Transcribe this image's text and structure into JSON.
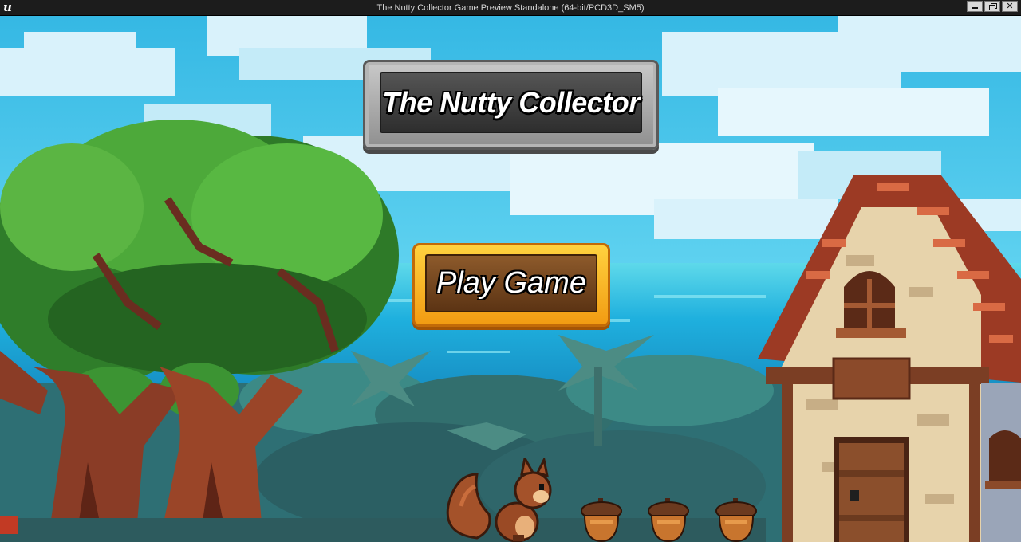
{
  "window": {
    "title": "The Nutty Collector Game Preview Standalone (64-bit/PCD3D_SM5)",
    "engine_icon": "unreal-engine-icon",
    "controls": [
      "minimize-icon",
      "restore-icon",
      "close-icon"
    ]
  },
  "menu": {
    "game_title": "The Nutty Collector",
    "play_label": "Play Game"
  },
  "scene": {
    "characters": [
      "squirrel"
    ],
    "collectibles": [
      "acorn",
      "acorn",
      "acorn"
    ],
    "props": [
      "tree",
      "tree",
      "cottage",
      "palm-tree",
      "ocean",
      "clouds"
    ]
  },
  "colors": {
    "sky": "#3fc3ea",
    "ocean": "#1ea7d8",
    "plaque_frame": "#9e9e9e",
    "button_frame": "#f7b21a",
    "wood": "#6e4020"
  }
}
